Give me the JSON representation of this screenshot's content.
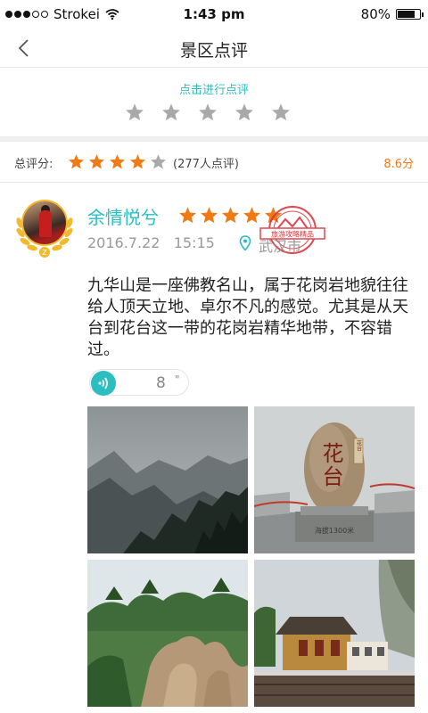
{
  "status_bar": {
    "carrier": "Strokei",
    "time": "1:43 pm",
    "battery": "80%",
    "battery_level": 0.8
  },
  "nav": {
    "title": "景区点评",
    "back_icon": "chevron-left-icon"
  },
  "rating_input": {
    "hint": "点击进行点评",
    "stars": 5,
    "star_color": "#a9a9a9"
  },
  "overall": {
    "label": "总评分:",
    "stars_filled": 4,
    "stars_total": 5,
    "count": "(277人点评)",
    "score": "8.6分",
    "accent_color": "#f07a16"
  },
  "review": {
    "user_name": "余情悦兮",
    "stars_filled": 5,
    "stamp_text": "旅游攻略精品",
    "date": "2016.7.22",
    "time": "15:15",
    "location": "武汉市",
    "location_icon": "location-pin-icon",
    "content": "九华山是一座佛教名山，属于花岗岩地貌往往给人顶天立地、卓尔不凡的感觉。尤其是从天台到花台这一带的花岗岩精华地带，不容错过。",
    "audio": {
      "icon": "voice-wave-icon",
      "duration": "8",
      "unit": "\""
    },
    "photo_captions": {
      "stone_carving": "花台",
      "small_plaque": "花台",
      "stone_base": "海拔1300米"
    }
  },
  "colors": {
    "teal": "#2bbdc0",
    "orange_star": "#f07a16",
    "stamp_red": "#d9363e"
  }
}
